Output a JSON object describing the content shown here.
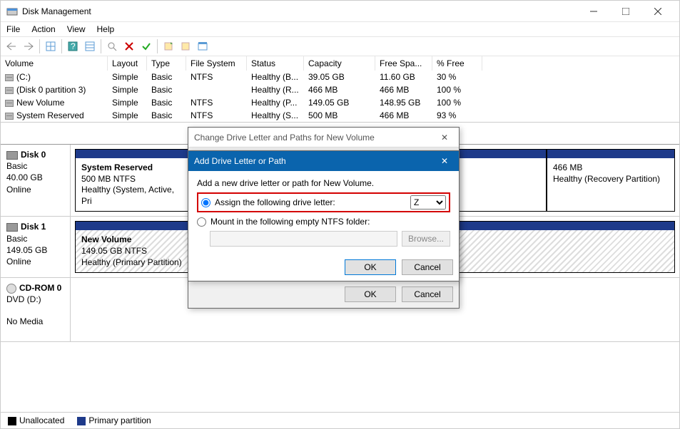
{
  "window": {
    "title": "Disk Management"
  },
  "menu": {
    "file": "File",
    "action": "Action",
    "view": "View",
    "help": "Help"
  },
  "table": {
    "headers": {
      "volume": "Volume",
      "layout": "Layout",
      "type": "Type",
      "fs": "File System",
      "status": "Status",
      "capacity": "Capacity",
      "free": "Free Spa...",
      "pct": "% Free"
    },
    "rows": [
      {
        "vol": "(C:)",
        "layout": "Simple",
        "type": "Basic",
        "fs": "NTFS",
        "status": "Healthy (B...",
        "cap": "39.05 GB",
        "free": "11.60 GB",
        "pct": "30 %"
      },
      {
        "vol": "(Disk 0 partition 3)",
        "layout": "Simple",
        "type": "Basic",
        "fs": "",
        "status": "Healthy (R...",
        "cap": "466 MB",
        "free": "466 MB",
        "pct": "100 %"
      },
      {
        "vol": "New Volume",
        "layout": "Simple",
        "type": "Basic",
        "fs": "NTFS",
        "status": "Healthy (P...",
        "cap": "149.05 GB",
        "free": "148.95 GB",
        "pct": "100 %"
      },
      {
        "vol": "System Reserved",
        "layout": "Simple",
        "type": "Basic",
        "fs": "NTFS",
        "status": "Healthy (S...",
        "cap": "500 MB",
        "free": "466 MB",
        "pct": "93 %"
      }
    ]
  },
  "disks": {
    "d0": {
      "name": "Disk 0",
      "type": "Basic",
      "size": "40.00 GB",
      "state": "Online",
      "p1": {
        "name": "System Reserved",
        "l2": "500 MB NTFS",
        "l3": "Healthy (System, Active, Pri"
      },
      "p3": {
        "l1": "466 MB",
        "l2": "Healthy (Recovery Partition)"
      }
    },
    "d1": {
      "name": "Disk 1",
      "type": "Basic",
      "size": "149.05 GB",
      "state": "Online",
      "p1": {
        "name": "New Volume",
        "l2": "149.05 GB NTFS",
        "l3": "Healthy (Primary Partition)"
      }
    },
    "cd": {
      "name": "CD-ROM 0",
      "l2": "DVD (D:)",
      "l3": "No Media"
    }
  },
  "legend": {
    "unalloc": "Unallocated",
    "primary": "Primary partition"
  },
  "dlg_outer": {
    "title": "Change Drive Letter and Paths for New Volume",
    "ok": "OK",
    "cancel": "Cancel"
  },
  "dlg_inner": {
    "title": "Add Drive Letter or Path",
    "intro": "Add a new drive letter or path for New Volume.",
    "opt1": "Assign the following drive letter:",
    "opt2": "Mount in the following empty NTFS folder:",
    "letter": "Z",
    "browse": "Browse...",
    "ok": "OK",
    "cancel": "Cancel"
  }
}
